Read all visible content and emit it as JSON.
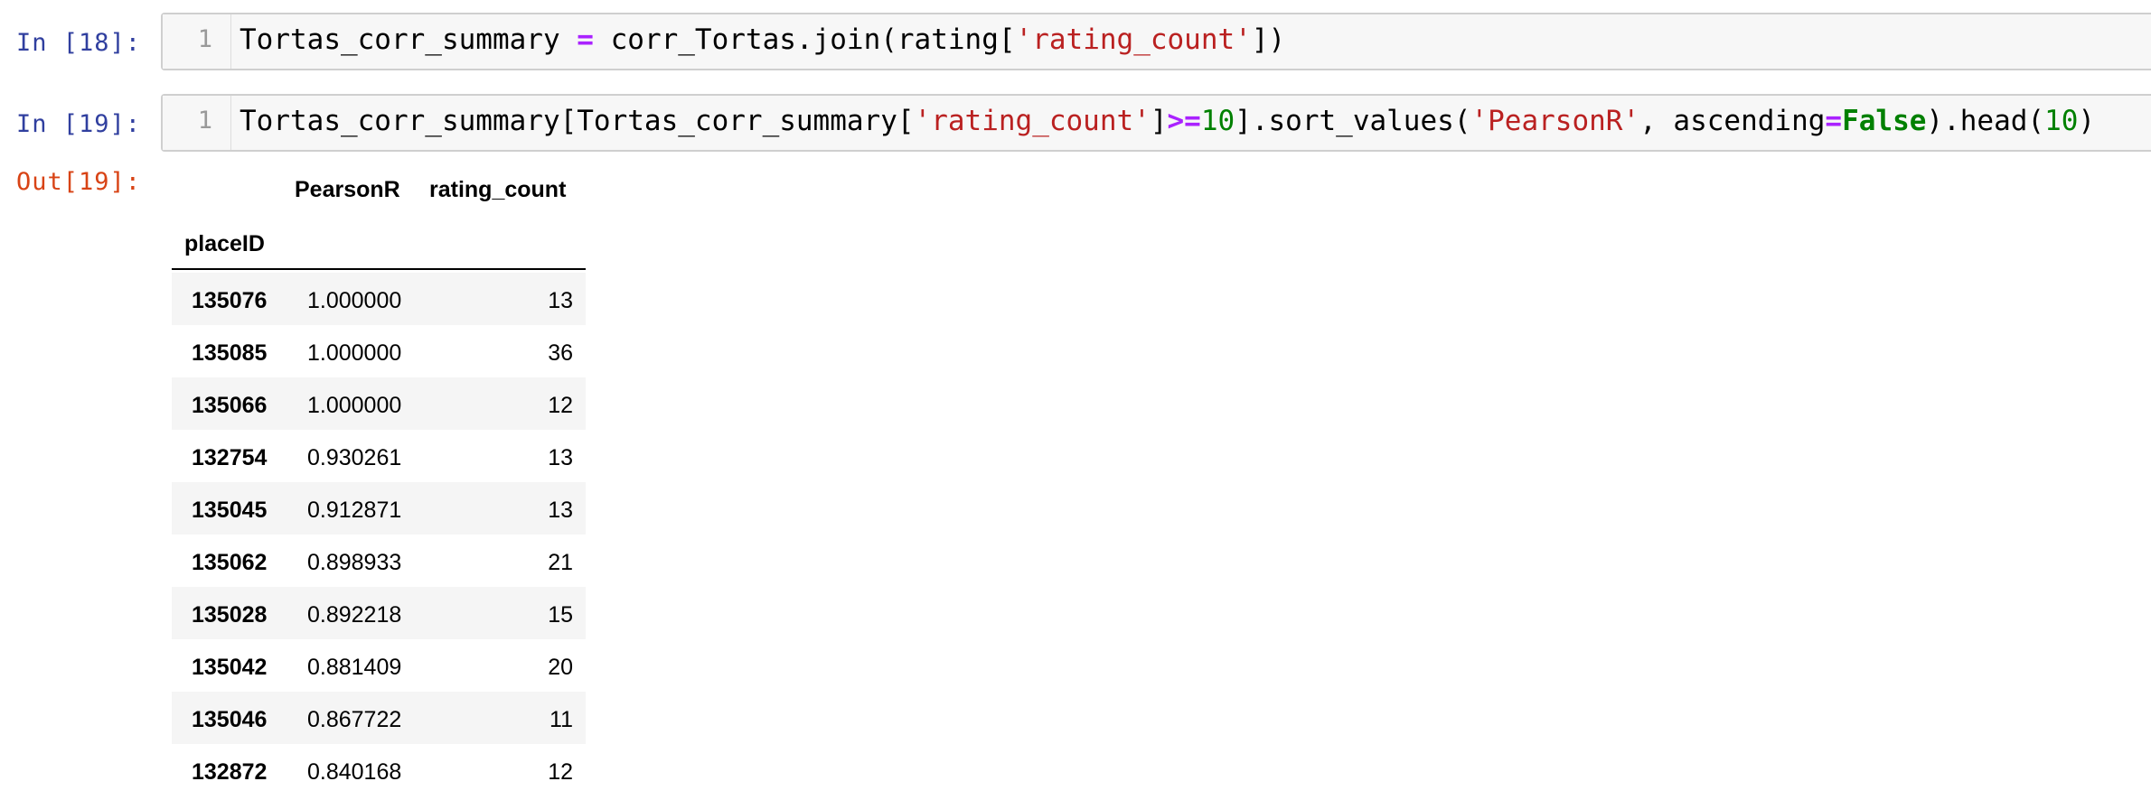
{
  "cells": [
    {
      "prompt": "In [18]:",
      "line_number": "1",
      "code_tokens": [
        {
          "t": "Tortas_corr_summary ",
          "c": ""
        },
        {
          "t": "=",
          "c": "op"
        },
        {
          "t": " corr_Tortas.join(rating[",
          "c": ""
        },
        {
          "t": "'rating_count'",
          "c": "str"
        },
        {
          "t": "])",
          "c": ""
        }
      ]
    },
    {
      "prompt": "In [19]:",
      "line_number": "1",
      "code_tokens": [
        {
          "t": "Tortas_corr_summary[Tortas_corr_summary[",
          "c": ""
        },
        {
          "t": "'rating_count'",
          "c": "str"
        },
        {
          "t": "]",
          "c": ""
        },
        {
          "t": ">=",
          "c": "op"
        },
        {
          "t": "10",
          "c": "num"
        },
        {
          "t": "].sort_values(",
          "c": ""
        },
        {
          "t": "'PearsonR'",
          "c": "str"
        },
        {
          "t": ", ascending",
          "c": ""
        },
        {
          "t": "=",
          "c": "op"
        },
        {
          "t": "False",
          "c": "kw"
        },
        {
          "t": ").head(",
          "c": ""
        },
        {
          "t": "10",
          "c": "num"
        },
        {
          "t": ")",
          "c": ""
        }
      ]
    }
  ],
  "output": {
    "prompt": "Out[19]:",
    "table": {
      "columns": [
        "PearsonR",
        "rating_count"
      ],
      "index_name": "placeID",
      "rows": [
        {
          "placeID": "135076",
          "PearsonR": "1.000000",
          "rating_count": "13"
        },
        {
          "placeID": "135085",
          "PearsonR": "1.000000",
          "rating_count": "36"
        },
        {
          "placeID": "135066",
          "PearsonR": "1.000000",
          "rating_count": "12"
        },
        {
          "placeID": "132754",
          "PearsonR": "0.930261",
          "rating_count": "13"
        },
        {
          "placeID": "135045",
          "PearsonR": "0.912871",
          "rating_count": "13"
        },
        {
          "placeID": "135062",
          "PearsonR": "0.898933",
          "rating_count": "21"
        },
        {
          "placeID": "135028",
          "PearsonR": "0.892218",
          "rating_count": "15"
        },
        {
          "placeID": "135042",
          "PearsonR": "0.881409",
          "rating_count": "20"
        },
        {
          "placeID": "135046",
          "PearsonR": "0.867722",
          "rating_count": "11"
        },
        {
          "placeID": "132872",
          "PearsonR": "0.840168",
          "rating_count": "12"
        }
      ]
    }
  },
  "colors": {
    "in_prompt": "#303F9F",
    "out_prompt": "#D84315",
    "string": "#BA2121",
    "operator": "#AA22FF",
    "number": "#008000",
    "keyword": "#008000"
  }
}
